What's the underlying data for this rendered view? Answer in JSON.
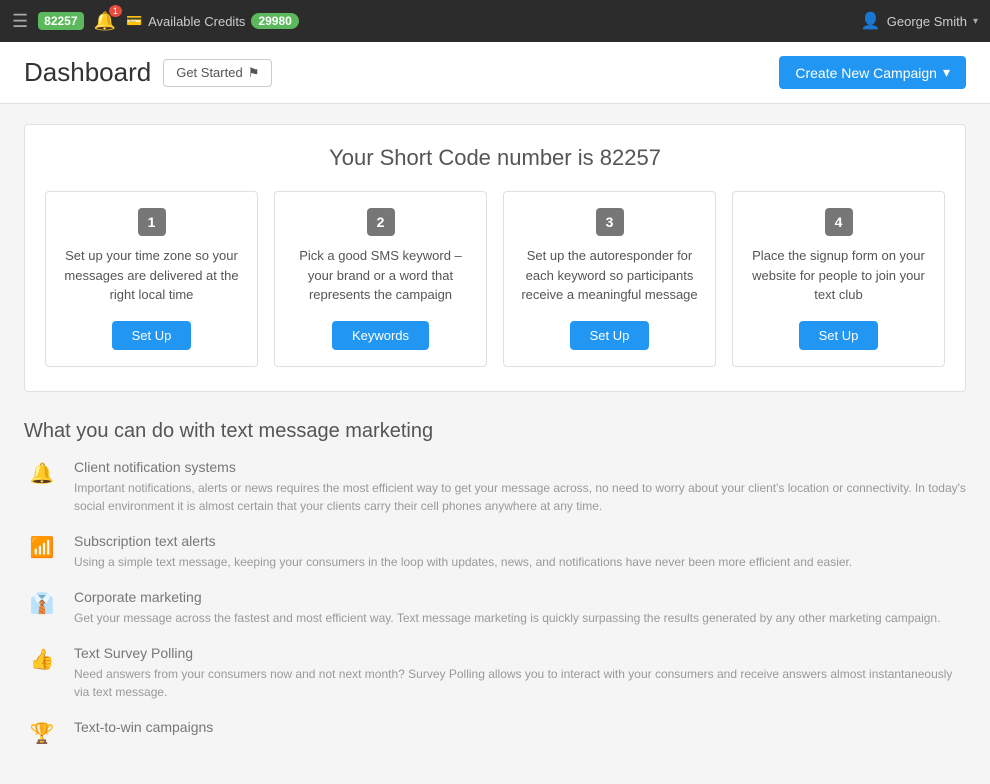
{
  "topnav": {
    "app_code": "82257",
    "notification_count": "1",
    "credits_label": "Available Credits",
    "credits_value": "29980",
    "user_name": "George Smith",
    "user_dropdown_label": "▾"
  },
  "header": {
    "title": "Dashboard",
    "get_started_label": "Get Started",
    "create_campaign_label": "Create New Campaign"
  },
  "shortcode_section": {
    "title_prefix": "Your Short Code number is",
    "short_code": "82257",
    "steps": [
      {
        "number": "1",
        "description": "Set up your time zone so your messages are delivered at the right local time",
        "button_label": "Set Up"
      },
      {
        "number": "2",
        "description": "Pick a good SMS keyword – your brand or a word that represents the campaign",
        "button_label": "Keywords"
      },
      {
        "number": "3",
        "description": "Set up the autoresponder for each keyword so participants receive a meaningful message",
        "button_label": "Set Up"
      },
      {
        "number": "4",
        "description": "Place the signup form on your website for people to join your text club",
        "button_label": "Set Up"
      }
    ]
  },
  "features_section": {
    "title": "What you can do with text message marketing",
    "items": [
      {
        "name": "Client notification systems",
        "description": "Important notifications, alerts or news requires the most efficient way to get your message across, no need to worry about your client's location or connectivity. In today's social environment it is almost certain that your clients carry their cell phones anywhere at any time.",
        "icon": "🔔"
      },
      {
        "name": "Subscription text alerts",
        "description": "Using a simple text message, keeping your consumers in the loop with updates, news, and notifications have never been more efficient and easier.",
        "icon": "📶"
      },
      {
        "name": "Corporate marketing",
        "description": "Get your message across the fastest and most efficient way. Text message marketing is quickly surpassing the results generated by any other marketing campaign.",
        "icon": "👔"
      },
      {
        "name": "Text Survey Polling",
        "description": "Need answers from your consumers now and not next month? Survey Polling allows you to interact with your consumers and receive answers almost instantaneously via text message.",
        "icon": "👍"
      },
      {
        "name": "Text-to-win campaigns",
        "description": "",
        "icon": "🏆"
      }
    ]
  }
}
